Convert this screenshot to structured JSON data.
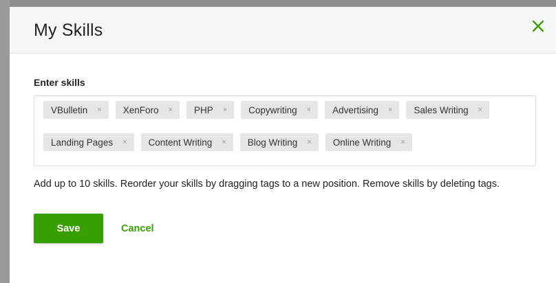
{
  "modal": {
    "title": "My Skills",
    "close_icon": "close-icon",
    "accent_color": "#37a000"
  },
  "form": {
    "label": "Enter skills",
    "tags": [
      {
        "label": "VBulletin"
      },
      {
        "label": "XenForo"
      },
      {
        "label": "PHP"
      },
      {
        "label": "Copywriting"
      },
      {
        "label": "Advertising"
      },
      {
        "label": "Sales Writing"
      },
      {
        "label": "Landing Pages"
      },
      {
        "label": "Content Writing"
      },
      {
        "label": "Blog Writing"
      },
      {
        "label": "Online Writing"
      }
    ],
    "remove_glyph": "×",
    "help_text": "Add up to 10 skills. Reorder your skills by dragging tags to a new position. Remove skills by deleting tags."
  },
  "actions": {
    "save_label": "Save",
    "cancel_label": "Cancel"
  }
}
